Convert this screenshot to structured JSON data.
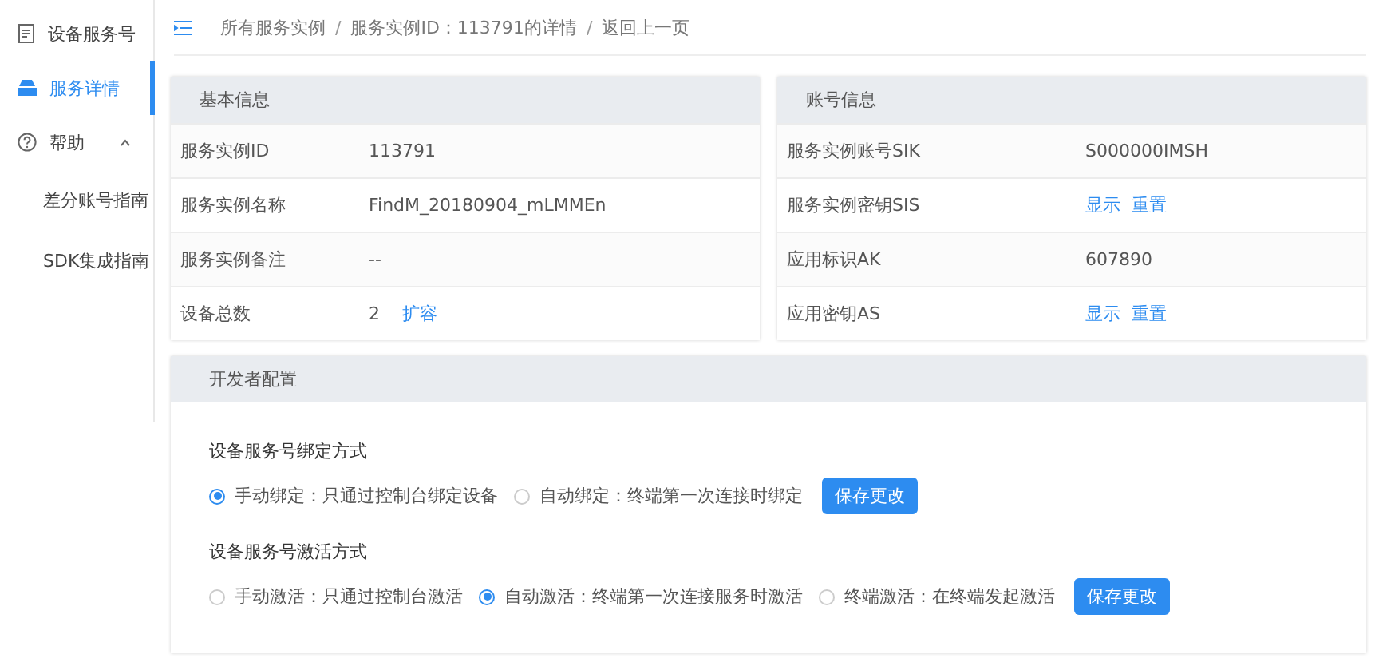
{
  "sidebar": {
    "items": [
      {
        "label": "设备服务号",
        "selected": false
      },
      {
        "label": "服务详情",
        "selected": true
      },
      {
        "label": "帮助",
        "selected": false,
        "expanded": true,
        "children": [
          {
            "label": "差分账号指南",
            "selected": false
          },
          {
            "label": "SDK集成指南",
            "selected": false
          }
        ]
      }
    ]
  },
  "breadcrumb": {
    "items": [
      "所有服务实例",
      "服务实例ID：113791的详情",
      "返回上一页"
    ],
    "separator": "/"
  },
  "cards": [
    {
      "title": "基本信息",
      "rows": [
        {
          "label": "服务实例ID",
          "value": "113791"
        },
        {
          "label": "服务实例名称",
          "value": "FindM_20180904_mLMMEn"
        },
        {
          "label": "服务实例备注",
          "value": "--"
        },
        {
          "label": "设备总数",
          "value": "2",
          "links": [
            "扩容"
          ]
        }
      ]
    },
    {
      "title": "账号信息",
      "rows": [
        {
          "label": "服务实例账号SIK",
          "value": "S000000IMSH"
        },
        {
          "label": "服务实例密钥SIS",
          "links": [
            "显示",
            "重置"
          ]
        },
        {
          "label": "应用标识AK",
          "value": "607890"
        },
        {
          "label": "应用密钥AS",
          "links": [
            "显示",
            "重置"
          ]
        }
      ]
    }
  ],
  "developer_config": {
    "title": "开发者配置",
    "groups": [
      {
        "title": "设备服务号绑定方式",
        "options": [
          {
            "label": "手动绑定：只通过控制台绑定设备",
            "selected": true
          },
          {
            "label": "自动绑定：终端第一次连接时绑定",
            "selected": false
          }
        ],
        "button": "保存更改"
      },
      {
        "title": "设备服务号激活方式",
        "options": [
          {
            "label": "手动激活：只通过控制台激活",
            "selected": false
          },
          {
            "label": "自动激活：终端第一次连接服务时激活",
            "selected": true
          },
          {
            "label": "终端激活：在终端发起激活",
            "selected": false
          }
        ],
        "button": "保存更改"
      }
    ]
  }
}
